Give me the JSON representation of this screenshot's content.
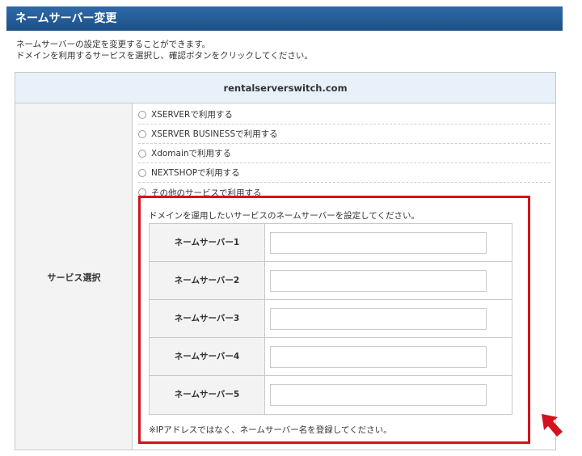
{
  "header": {
    "title": "ネームサーバー変更"
  },
  "description": {
    "line1": "ネームサーバーの設定を変更することができます。",
    "line2": "ドメインを利用するサービスを選択し、確認ボタンをクリックしてください。"
  },
  "domain": "rentalserverswitch.com",
  "service_label": "サービス選択",
  "options": [
    {
      "label": "XSERVERで利用する"
    },
    {
      "label": "XSERVER BUSINESSで利用する"
    },
    {
      "label": "Xdomainで利用する"
    },
    {
      "label": "NEXTSHOPで利用する"
    },
    {
      "label": "その他のサービスで利用する"
    }
  ],
  "nameservers": {
    "intro": "ドメインを運用したいサービスのネームサーバーを設定してください。",
    "rows": [
      {
        "label": "ネームサーバー1",
        "value": ""
      },
      {
        "label": "ネームサーバー2",
        "value": ""
      },
      {
        "label": "ネームサーバー3",
        "value": ""
      },
      {
        "label": "ネームサーバー4",
        "value": ""
      },
      {
        "label": "ネームサーバー5",
        "value": ""
      }
    ],
    "note": "※IPアドレスではなく、ネームサーバー名を登録してください。"
  },
  "colors": {
    "header_bg": "#1d4f87",
    "highlight": "#d3121e",
    "domain_bg": "#e8f1fa"
  },
  "icons": {
    "annotation": "arrow-icon",
    "radio": "radio-button"
  }
}
